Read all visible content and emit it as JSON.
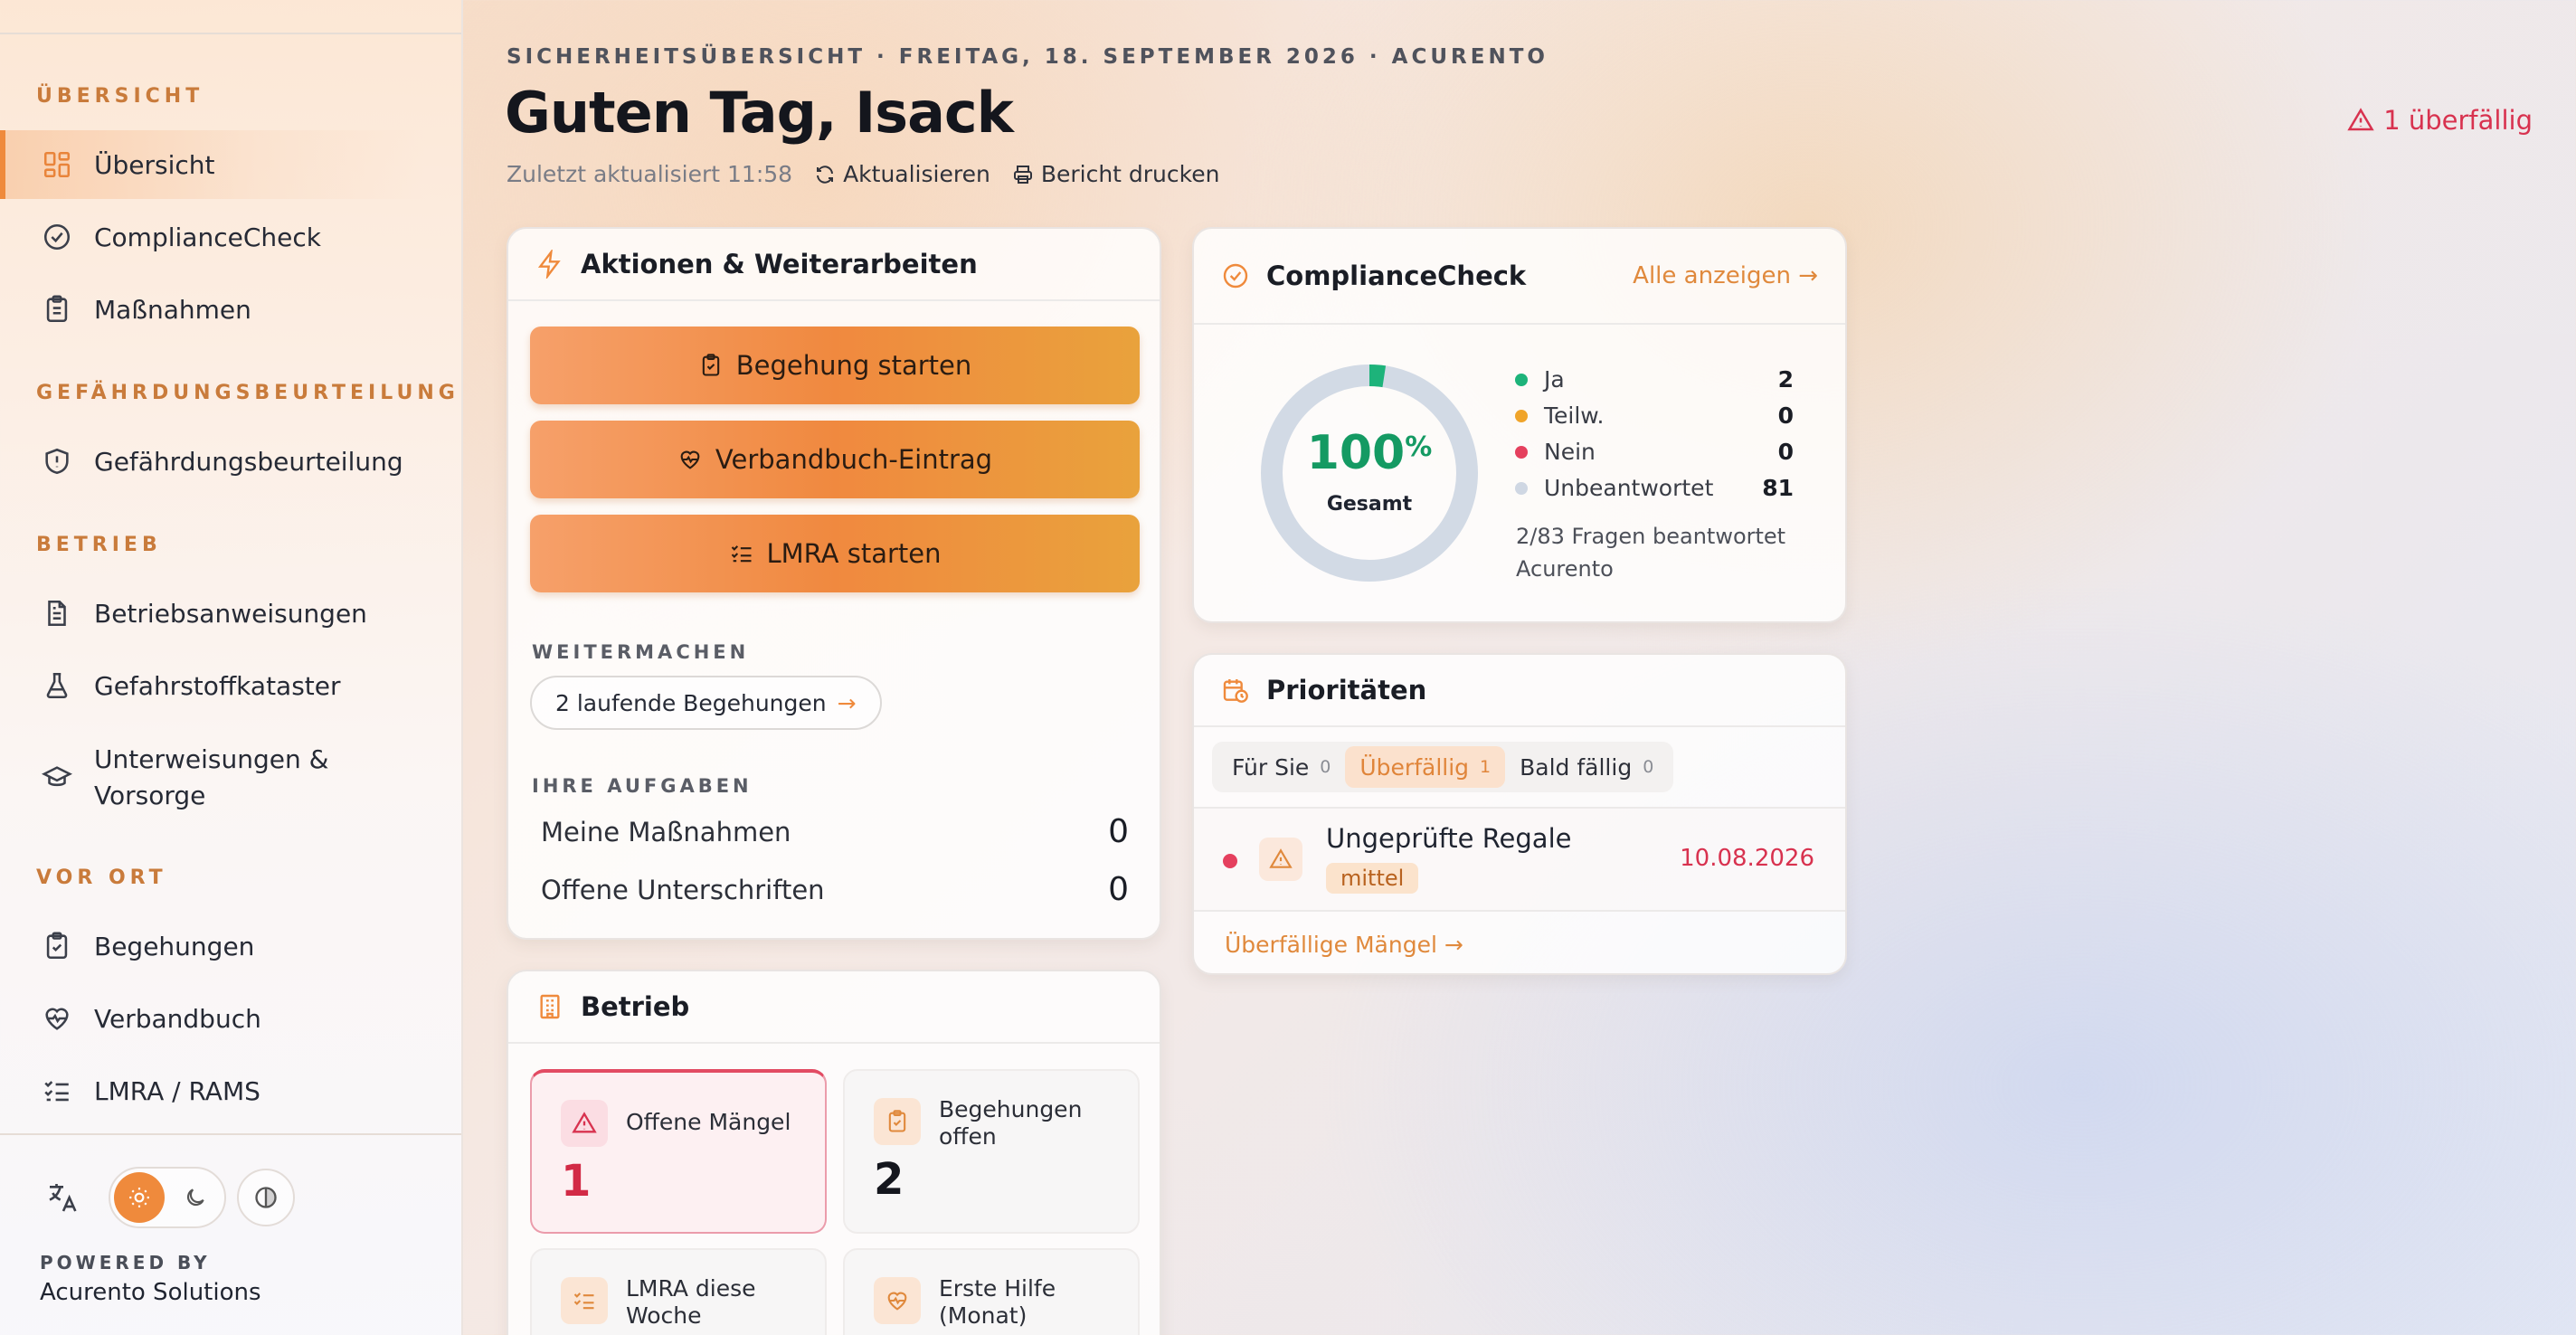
{
  "sidebar": {
    "sections": [
      {
        "title": "ÜBERSICHT",
        "items": [
          "Übersicht",
          "ComplianceCheck",
          "Maßnahmen"
        ]
      },
      {
        "title": "GEFÄHRDUNGSBEURTEILUNG",
        "items": [
          "Gefährdungsbeurteilung"
        ]
      },
      {
        "title": "BETRIEB",
        "items": [
          "Betriebsanweisungen",
          "Gefahrstoffkataster",
          "Unterweisungen & Vorsorge"
        ]
      },
      {
        "title": "VOR ORT",
        "items": [
          "Begehungen",
          "Verbandbuch",
          "LMRA / RAMS"
        ]
      }
    ],
    "powered_by": "POWERED BY",
    "company": "Acurento Solutions"
  },
  "header": {
    "breadcrumb": "SICHERHEITSÜBERSICHT · FREITAG, 18. SEPTEMBER 2026 · ACURENTO",
    "greeting": "Guten Tag, Isack",
    "last_updated": "Zuletzt aktualisiert 11:58",
    "refresh_label": "Aktualisieren",
    "print_label": "Bericht drucken",
    "overdue_flag": "1 überfällig"
  },
  "actions": {
    "title": "Aktionen & Weiterarbeiten",
    "buttons": [
      "Begehung starten",
      "Verbandbuch-Eintrag",
      "LMRA starten"
    ],
    "continue_label": "WEITERMACHEN",
    "continue_pill": "2 laufende Begehungen",
    "tasks_label": "IHRE AUFGABEN",
    "tasks": [
      {
        "label": "Meine Maßnahmen",
        "value": "0"
      },
      {
        "label": "Offene Unterschriften",
        "value": "0"
      }
    ]
  },
  "compliance": {
    "title": "ComplianceCheck",
    "link": "Alle anzeigen",
    "percent": "100",
    "percent_sign": "%",
    "gauge_label": "Gesamt",
    "answered": 2,
    "total": 83,
    "legend": [
      {
        "label": "Ja",
        "value": "2",
        "color": "#1db37a"
      },
      {
        "label": "Teilw.",
        "value": "0",
        "color": "#f0a42a"
      },
      {
        "label": "Nein",
        "value": "0",
        "color": "#e5405e"
      },
      {
        "label": "Unbeantwortet",
        "value": "81",
        "color": "#cfd7e3"
      }
    ],
    "summary_line1": "2/83 Fragen beantwortet",
    "summary_line2": "Acurento"
  },
  "priorities": {
    "title": "Prioritäten",
    "tabs": [
      {
        "label": "Für Sie",
        "count": "0"
      },
      {
        "label": "Überfällig",
        "count": "1"
      },
      {
        "label": "Bald fällig",
        "count": "0"
      }
    ],
    "item": {
      "title": "Ungeprüfte Regale",
      "badge": "mittel",
      "date": "10.08.2026"
    },
    "footer_link": "Überfällige Mängel"
  },
  "betrieb": {
    "title": "Betrieb",
    "tiles": [
      {
        "label": "Offene Mängel",
        "value": "1"
      },
      {
        "label_1": "Begehungen",
        "label_2": "offen",
        "value": "2"
      },
      {
        "label_1": "LMRA diese",
        "label_2": "Woche"
      },
      {
        "label_1": "Erste Hilfe",
        "label_2": "(Monat)"
      }
    ]
  },
  "colors": {
    "accent": "#ef8a3c",
    "danger": "#d8324f",
    "success": "#1db37a"
  }
}
